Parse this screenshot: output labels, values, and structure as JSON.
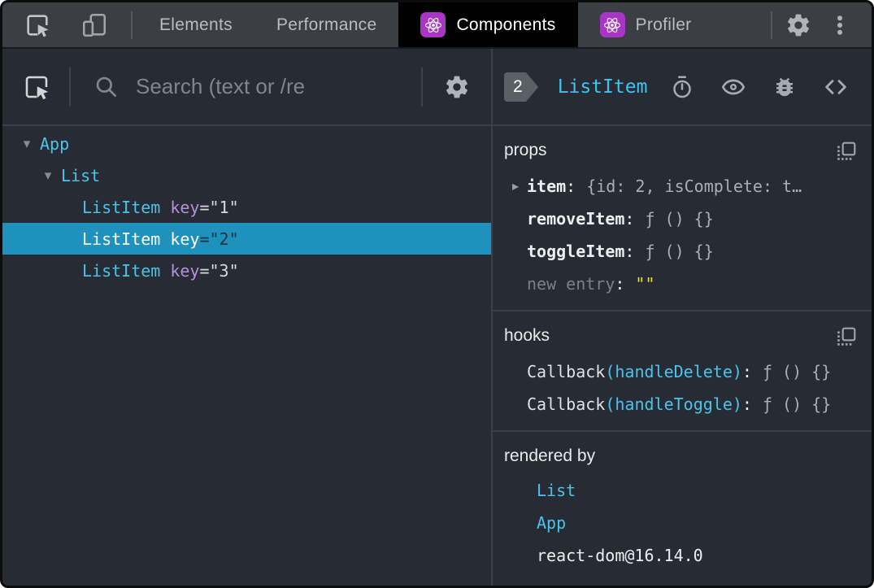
{
  "colors": {
    "accent_cyan": "#4cc3ea",
    "selection_blue": "#1f91bd",
    "key_purple": "#b88fd9",
    "empty_string_yellow": "#e7e411",
    "react_icon_purple": "#a935c6",
    "active_tab_bg": "#000000",
    "panel_bg": "#272b34",
    "toolbar_bg": "#3b3e43"
  },
  "topbar": {
    "tabs": [
      {
        "label": "Elements",
        "active": false,
        "has_icon": false
      },
      {
        "label": "Performance",
        "active": false,
        "has_icon": false
      },
      {
        "label": "Components",
        "active": true,
        "has_icon": true
      },
      {
        "label": "Profiler",
        "active": false,
        "has_icon": true
      }
    ]
  },
  "left": {
    "search_placeholder": "Search (text or /re",
    "tree": [
      {
        "arrow": "▾",
        "label": "App"
      },
      {
        "arrow": "▾",
        "label": "List"
      },
      {
        "label": "ListItem",
        "attr_name": "key",
        "eq": "=",
        "attr_value": "\"1\""
      },
      {
        "label": "ListItem",
        "attr_name": "key",
        "eq": "=",
        "attr_value": "\"2\""
      },
      {
        "label": "ListItem",
        "attr_name": "key",
        "eq": "=",
        "attr_value": "\"3\""
      }
    ]
  },
  "right": {
    "header": {
      "badge": "2",
      "title": "ListItem"
    },
    "props": {
      "title": "props",
      "rows": [
        {
          "arrow": "▸",
          "name": "item",
          "sep": ":",
          "value": "{id: 2, isComplete: t…"
        },
        {
          "arrow": "",
          "name": "removeItem",
          "sep": ":",
          "value": "ƒ () {}"
        },
        {
          "arrow": "",
          "name": "toggleItem",
          "sep": ":",
          "value": "ƒ () {}"
        },
        {
          "arrow": "",
          "name": "new entry",
          "sep": ":",
          "value": "\"\""
        }
      ]
    },
    "hooks": {
      "title": "hooks",
      "rows": [
        {
          "fn": "Callback",
          "arg": "(handleDelete)",
          "sep": ":",
          "value": "ƒ () {}"
        },
        {
          "fn": "Callback",
          "arg": "(handleToggle)",
          "sep": ":",
          "value": "ƒ () {}"
        }
      ]
    },
    "rendered_by": {
      "title": "rendered by",
      "items": [
        {
          "label": "List",
          "link": true
        },
        {
          "label": "App",
          "link": true
        },
        {
          "label": "react-dom@16.14.0",
          "link": false
        }
      ]
    }
  }
}
